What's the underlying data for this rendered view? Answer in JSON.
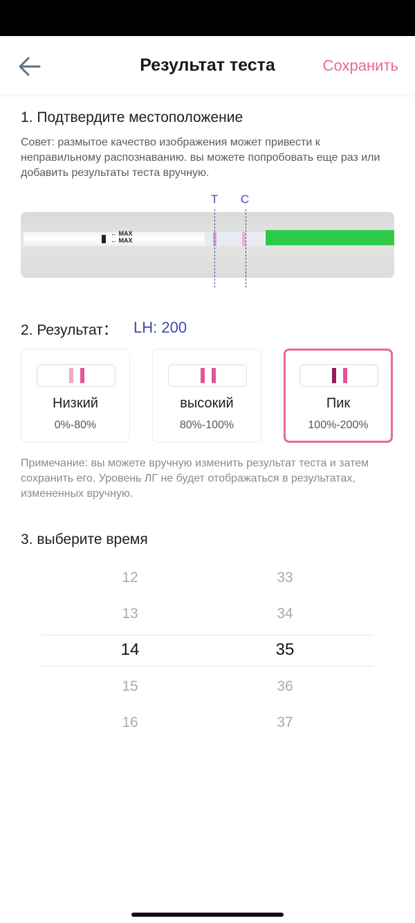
{
  "header": {
    "title": "Результат теста",
    "save_label": "Сохранить",
    "back_icon": "arrow-left-icon"
  },
  "section1": {
    "title": "1. Подтвердите местоположение",
    "hint": "Совет: размытое качество изображения может привести к неправильному распознаванию. вы можете попробовать еще раз или добавить результаты теста вручную.",
    "marker_t": "T",
    "marker_c": "C",
    "strip_text": [
      "MAX",
      "MAX"
    ]
  },
  "section2": {
    "title": "2. Результат：",
    "lh_value": "LH: 200",
    "options": [
      {
        "label": "Низкий",
        "range": "0%-80%",
        "selected": false
      },
      {
        "label": "высокий",
        "range": "80%-100%",
        "selected": false
      },
      {
        "label": "Пик",
        "range": "100%-200%",
        "selected": true
      }
    ],
    "note": "Примечание: вы можете вручную изменить результат теста и затем сохранить его. Уровень ЛГ не будет отображаться в результатах, измененных вручную."
  },
  "section3": {
    "title": "3. выберите время",
    "hours": [
      "12",
      "13",
      "14",
      "15",
      "16"
    ],
    "minutes": [
      "33",
      "34",
      "35",
      "36",
      "37"
    ],
    "selected_hour": "14",
    "selected_minute": "35"
  },
  "colors": {
    "accent_pink": "#e8689c",
    "marker_blue": "#4b4bb7",
    "strip_green": "#2fc94a",
    "line_light": "#f2a7c8",
    "line_medium": "#e3559a",
    "line_dark": "#9a1a5a"
  }
}
